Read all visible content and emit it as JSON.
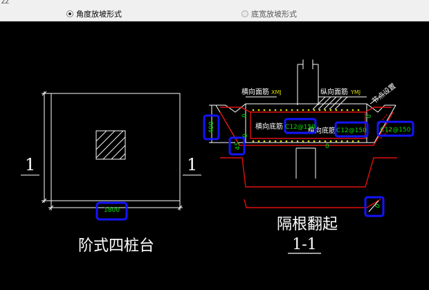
{
  "window": {
    "corner_text": "ZZ"
  },
  "options": [
    {
      "label": "角度放坡形式",
      "selected": true
    },
    {
      "label": "底宽放坡形式",
      "selected": false
    }
  ],
  "plan": {
    "section_mark_left": "1",
    "section_mark_right": "1",
    "width_dim": "1800",
    "title": "阶式四桩台"
  },
  "section": {
    "transverse_top_label": "横向面筋",
    "transverse_top_code": "XMJ",
    "longitudinal_top_label": "纵向面筋",
    "longitudinal_top_code": "YMJ",
    "anchor_label": "节点设置",
    "transverse_bottom_label": "横向底筋",
    "longitudinal_bottom_label": "纵向底筋",
    "rebar_1": "C12@150",
    "rebar_2": "C12@150",
    "rebar_3": "C12@150",
    "height_dim": "400",
    "angle_dim": "45",
    "zero_1": "0",
    "zero_2": "0",
    "zero_3": "0",
    "zero_4": "0",
    "zero_5": "0",
    "title": "隔根翻起",
    "section_label": "1-1"
  },
  "colors": {
    "highlight": "#1414ff",
    "rebar_text": "#00e000",
    "cad_white": "#ffffff",
    "cad_red": "#e01010",
    "code_yellow": "#d8d800"
  }
}
